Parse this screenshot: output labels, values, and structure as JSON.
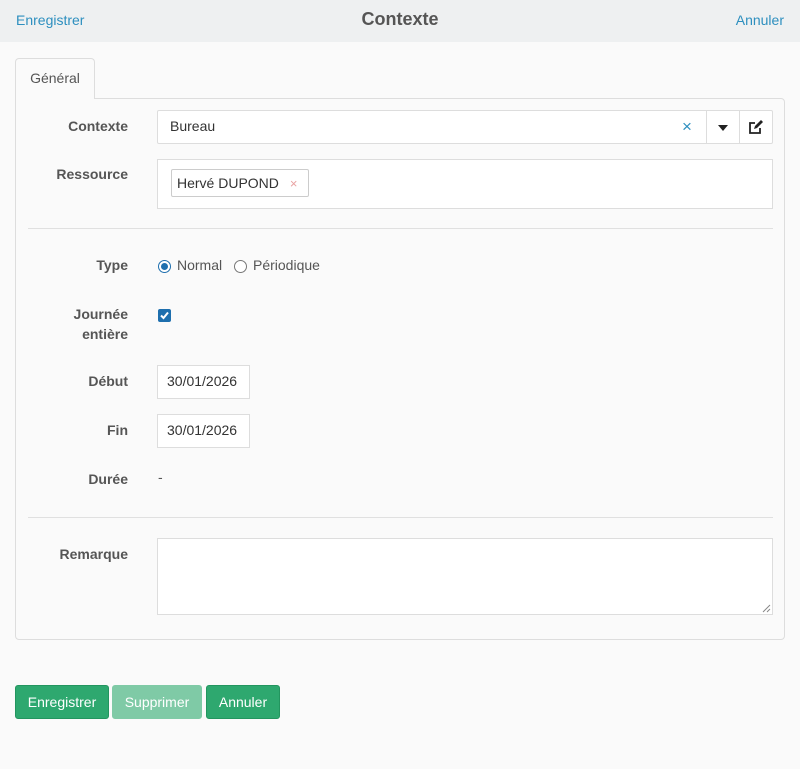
{
  "topbar": {
    "left_action": "Enregistrer",
    "title": "Contexte",
    "right_action": "Annuler"
  },
  "tabs": [
    {
      "label": "Général",
      "active": true
    }
  ],
  "form": {
    "contexte": {
      "label": "Contexte",
      "value": "Bureau",
      "clear_icon": "×"
    },
    "ressource": {
      "label": "Ressource",
      "tags": [
        {
          "text": "Hervé DUPOND",
          "remove_icon": "×"
        }
      ]
    },
    "type": {
      "label": "Type",
      "options": [
        {
          "label": "Normal",
          "checked": true
        },
        {
          "label": "Périodique",
          "checked": false
        }
      ]
    },
    "journee_entiere": {
      "label_line1": "Journée",
      "label_line2": "entière",
      "checked": true
    },
    "debut": {
      "label": "Début",
      "value": "30/01/2026"
    },
    "fin": {
      "label": "Fin",
      "value": "30/01/2026"
    },
    "duree": {
      "label": "Durée",
      "value": "-"
    },
    "remarque": {
      "label": "Remarque",
      "value": ""
    }
  },
  "buttons": {
    "save": "Enregistrer",
    "delete": "Supprimer",
    "cancel": "Annuler"
  },
  "colors": {
    "link": "#2d8fbf",
    "primary_button": "#2ea86f",
    "disabled_button": "#7fcaa6",
    "radio_checkbox": "#1e6fae"
  },
  "icons": {
    "dropdown": "caret-down-icon",
    "edit": "edit-icon",
    "clear": "clear-icon",
    "resize": "resize-grip-icon"
  }
}
